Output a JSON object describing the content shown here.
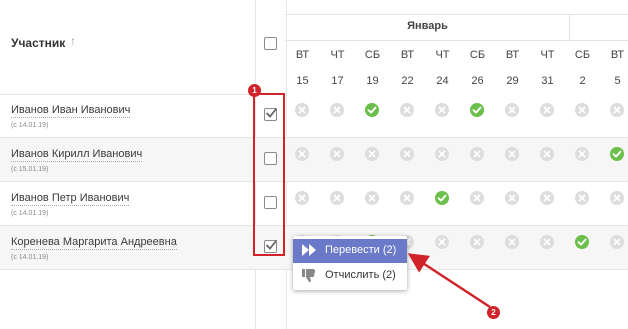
{
  "header": {
    "participant_title": "Участник",
    "sort_glyph": "↑"
  },
  "calendar": {
    "month_label": "Январь",
    "days": [
      {
        "dow": "ВТ",
        "num": "15"
      },
      {
        "dow": "ЧТ",
        "num": "17"
      },
      {
        "dow": "СБ",
        "num": "19"
      },
      {
        "dow": "ВТ",
        "num": "22"
      },
      {
        "dow": "ЧТ",
        "num": "24"
      },
      {
        "dow": "СБ",
        "num": "26"
      },
      {
        "dow": "ВТ",
        "num": "29"
      },
      {
        "dow": "ЧТ",
        "num": "31"
      },
      {
        "dow": "СБ",
        "num": "2"
      },
      {
        "dow": "ВТ",
        "num": "5"
      }
    ]
  },
  "participants": [
    {
      "name": "Иванов Иван Иванович",
      "since": "(с 14.01.19)",
      "checked": true,
      "attendance": [
        false,
        false,
        true,
        false,
        false,
        true,
        false,
        false,
        false,
        false
      ]
    },
    {
      "name": "Иванов Кирилл Иванович",
      "since": "(с 15.01.19)",
      "checked": false,
      "attendance": [
        false,
        false,
        false,
        false,
        false,
        false,
        false,
        false,
        false,
        true
      ]
    },
    {
      "name": "Иванов Петр Иванович",
      "since": "(с 14.01.19)",
      "checked": false,
      "attendance": [
        false,
        false,
        false,
        false,
        true,
        false,
        false,
        false,
        false,
        false
      ]
    },
    {
      "name": "Коренева Маргарита Андреевна",
      "since": "(с 14.01.19)",
      "checked": true,
      "attendance": [
        false,
        false,
        true,
        false,
        false,
        false,
        false,
        false,
        true,
        false
      ]
    }
  ],
  "context_menu": {
    "transfer_label": "Перевести (2)",
    "expel_label": "Отчислить (2)"
  },
  "annotations": {
    "badge_1": "1",
    "badge_2": "2",
    "accent_color": "#d0232a"
  },
  "colors": {
    "present": "#6cbf4b",
    "absent": "#dddddd",
    "menu_active": "#6b79c9"
  }
}
